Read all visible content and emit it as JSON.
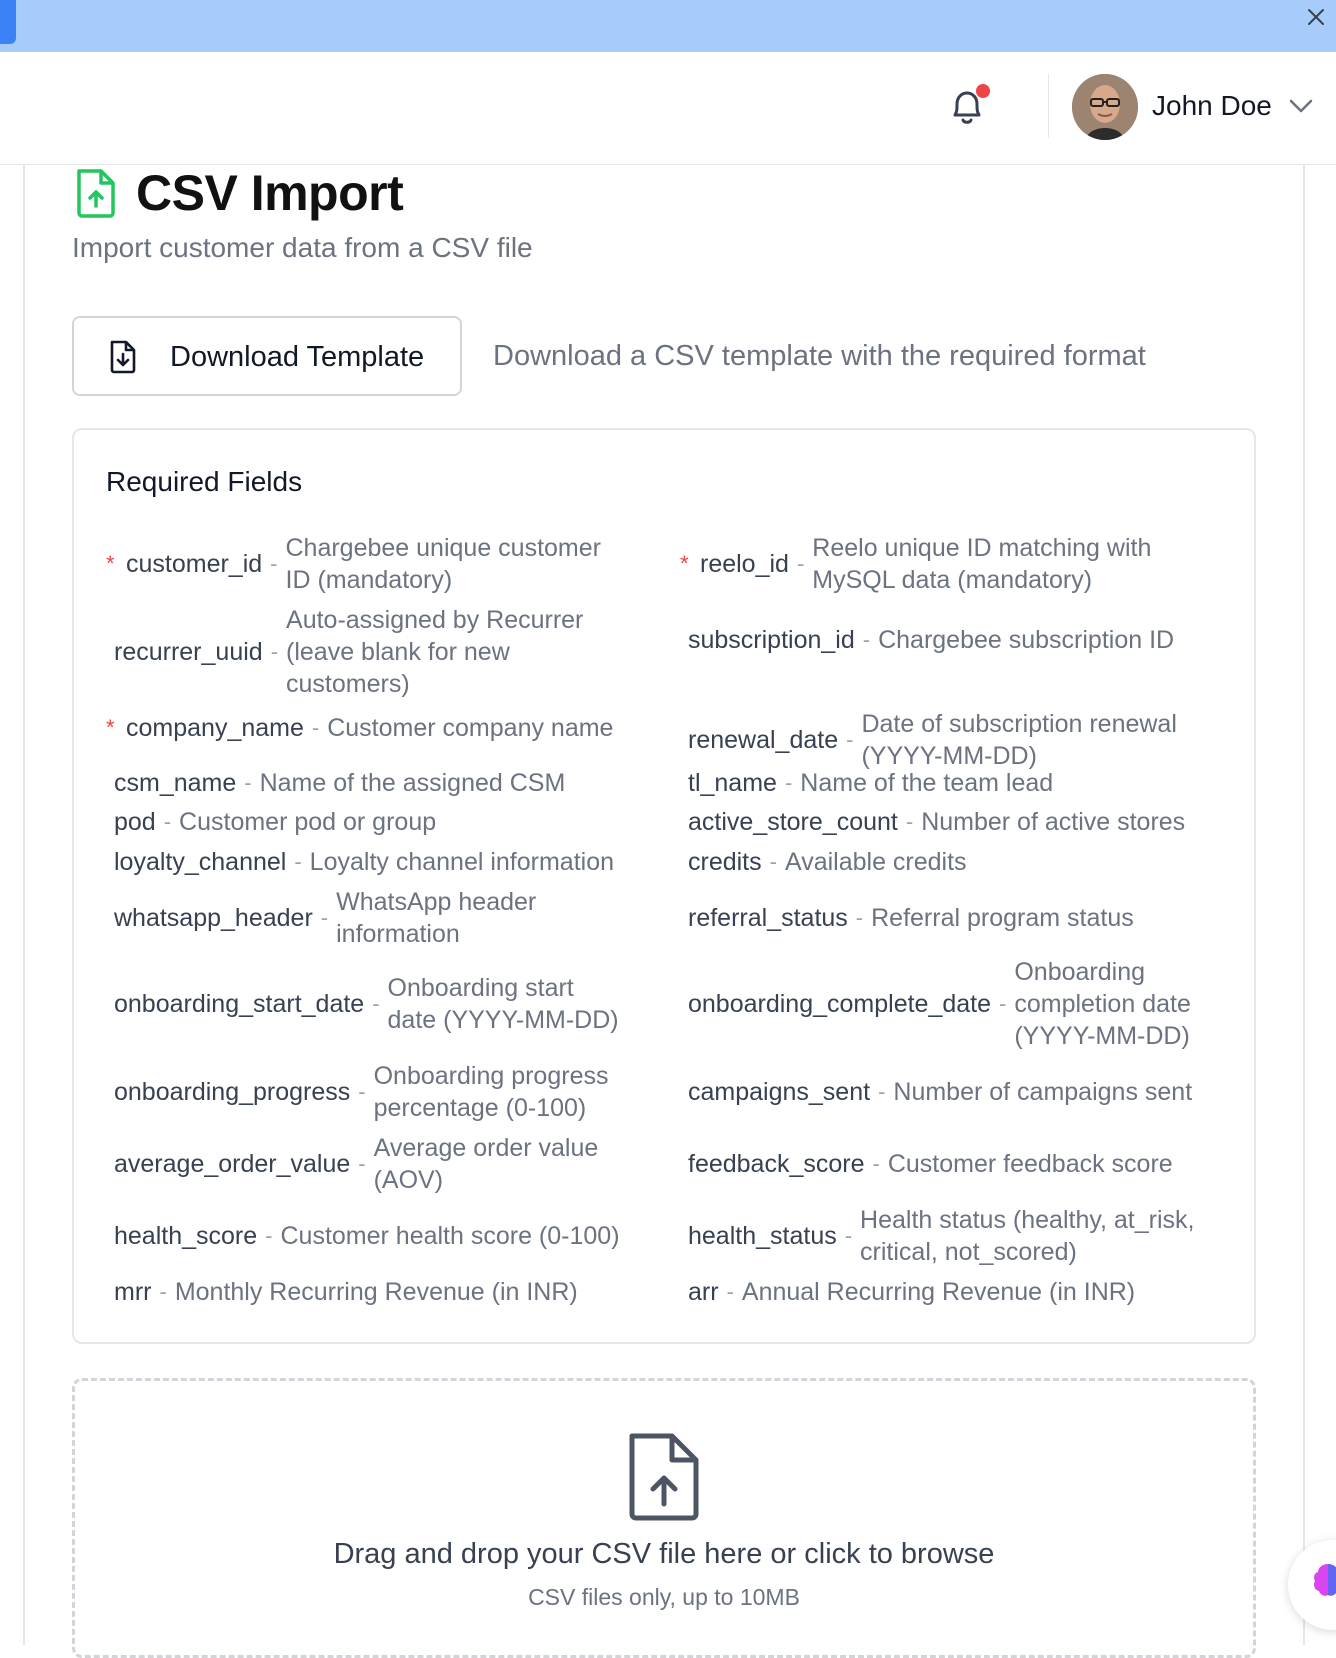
{
  "banner": {
    "close_icon": "close-icon",
    "color": "#a7ccfb"
  },
  "topbar": {
    "notification_icon": "bell-icon",
    "user": {
      "name": "John Doe",
      "menu_icon": "chevron-down-icon"
    }
  },
  "page": {
    "icon": "file-upload-icon",
    "title": "CSV Import",
    "subtitle": "Import customer data from a CSV file",
    "accent": "#22c55e"
  },
  "template": {
    "button_label": "Download Template",
    "button_icon": "file-download-icon",
    "description": "Download a CSV template with the required format"
  },
  "required_fields": {
    "title": "Required Fields",
    "fields": [
      {
        "name": "customer_id",
        "desc": "Chargebee unique customer ID (mandatory)",
        "required": true
      },
      {
        "name": "reelo_id",
        "desc": "Reelo unique ID matching with MySQL data (mandatory)",
        "required": true
      },
      {
        "name": "recurrer_uuid",
        "desc": "Auto-assigned by Recurrer (leave blank for new customers)",
        "required": false
      },
      {
        "name": "subscription_id",
        "desc": "Chargebee subscription ID",
        "required": false
      },
      {
        "name": "company_name",
        "desc": "Customer company name",
        "required": true
      },
      {
        "name": "renewal_date",
        "desc": "Date of subscription renewal (YYYY-MM-DD)",
        "required": false
      },
      {
        "name": "csm_name",
        "desc": "Name of the assigned CSM",
        "required": false
      },
      {
        "name": "tl_name",
        "desc": "Name of the team lead",
        "required": false
      },
      {
        "name": "pod",
        "desc": "Customer pod or group",
        "required": false
      },
      {
        "name": "active_store_count",
        "desc": "Number of active stores",
        "required": false
      },
      {
        "name": "loyalty_channel",
        "desc": "Loyalty channel information",
        "required": false
      },
      {
        "name": "credits",
        "desc": "Available credits",
        "required": false
      },
      {
        "name": "whatsapp_header",
        "desc": "WhatsApp header information",
        "required": false
      },
      {
        "name": "referral_status",
        "desc": "Referral program status",
        "required": false
      },
      {
        "name": "onboarding_start_date",
        "desc": "Onboarding start date (YYYY-MM-DD)",
        "required": false
      },
      {
        "name": "onboarding_complete_date",
        "desc": "Onboarding completion date (YYYY-MM-DD)",
        "required": false
      },
      {
        "name": "onboarding_progress",
        "desc": "Onboarding progress percentage (0-100)",
        "required": false
      },
      {
        "name": "campaigns_sent",
        "desc": "Number of campaigns sent",
        "required": false
      },
      {
        "name": "average_order_value",
        "desc": "Average order value (AOV)",
        "required": false
      },
      {
        "name": "feedback_score",
        "desc": "Customer feedback score",
        "required": false
      },
      {
        "name": "health_score",
        "desc": "Customer health score (0-100)",
        "required": false
      },
      {
        "name": "health_status",
        "desc": "Health status (healthy, at_risk, critical, not_scored)",
        "required": false
      },
      {
        "name": "mrr",
        "desc": "Monthly Recurring Revenue (in INR)",
        "required": false
      },
      {
        "name": "arr",
        "desc": "Annual Recurring Revenue (in INR)",
        "required": false
      }
    ]
  },
  "dropzone": {
    "icon": "file-upload-icon",
    "text": "Drag and drop your CSV file here or click to browse",
    "subtext": "CSV files only, up to 10MB"
  },
  "assistant": {
    "icon": "brain-icon"
  }
}
